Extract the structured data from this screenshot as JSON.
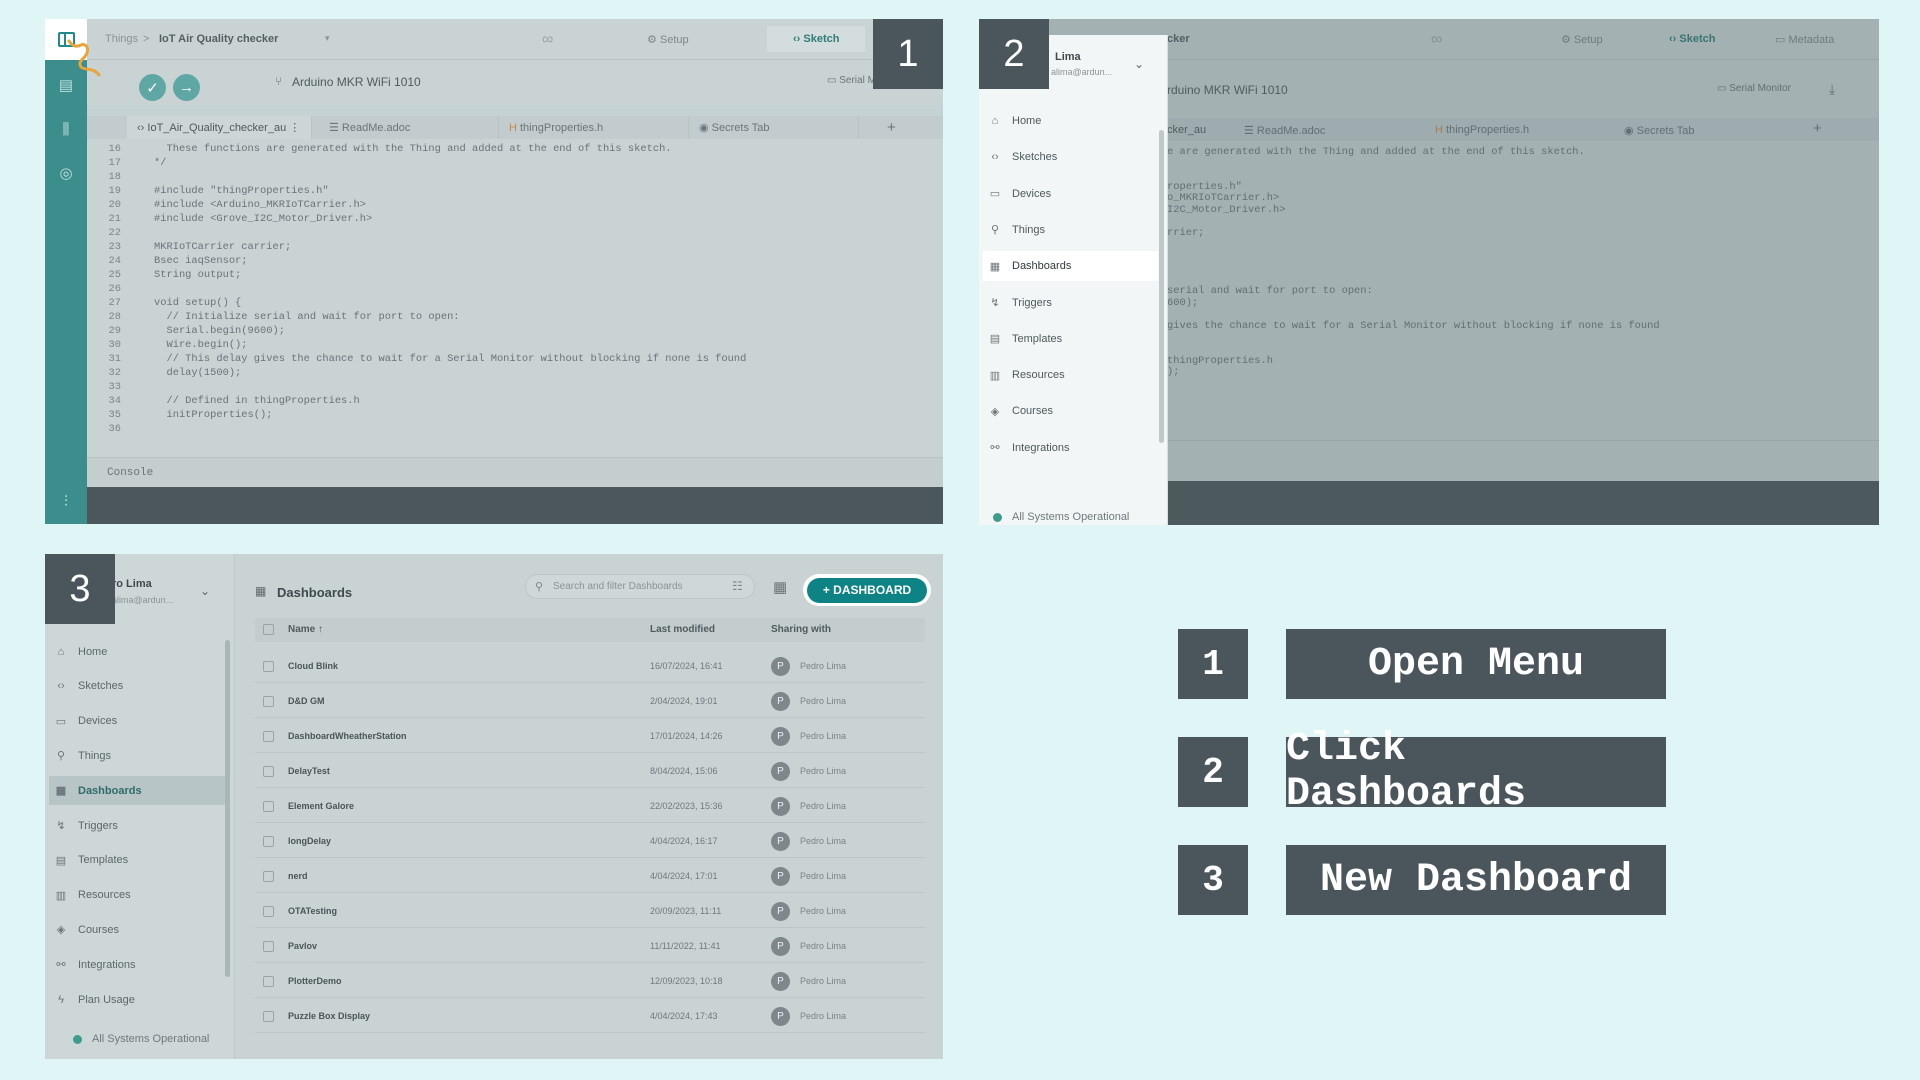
{
  "panel1": {
    "badge": "1",
    "breadcrumb": [
      "Things",
      "IoT Air Quality checker"
    ],
    "topbar": {
      "setup": "Setup",
      "sketch": "Sketch"
    },
    "board": "Arduino MKR WiFi 1010",
    "serial_monitor": "Serial Monitor",
    "tabs": [
      "IoT_Air_Quality_checker_au",
      "ReadMe.adoc",
      "thingProperties.h",
      "Secrets Tab"
    ],
    "code": [
      {
        "n": "16",
        "t": "  These functions are generated with the Thing and added at the end of this sketch."
      },
      {
        "n": "17",
        "t": "*/"
      },
      {
        "n": "18",
        "t": ""
      },
      {
        "n": "19",
        "t": "#include \"thingProperties.h\""
      },
      {
        "n": "20",
        "t": "#include <Arduino_MKRIoTCarrier.h>"
      },
      {
        "n": "21",
        "t": "#include <Grove_I2C_Motor_Driver.h>"
      },
      {
        "n": "22",
        "t": ""
      },
      {
        "n": "23",
        "t": "MKRIoTCarrier carrier;"
      },
      {
        "n": "24",
        "t": "Bsec iaqSensor;"
      },
      {
        "n": "25",
        "t": "String output;"
      },
      {
        "n": "26",
        "t": ""
      },
      {
        "n": "27",
        "t": "void setup() {"
      },
      {
        "n": "28",
        "t": "  // Initialize serial and wait for port to open:"
      },
      {
        "n": "29",
        "t": "  Serial.begin(9600);"
      },
      {
        "n": "30",
        "t": "  Wire.begin();"
      },
      {
        "n": "31",
        "t": "  // This delay gives the chance to wait for a Serial Monitor without blocking if none is found"
      },
      {
        "n": "32",
        "t": "  delay(1500);"
      },
      {
        "n": "33",
        "t": ""
      },
      {
        "n": "34",
        "t": "  // Defined in thingProperties.h"
      },
      {
        "n": "35",
        "t": "  initProperties();"
      },
      {
        "n": "36",
        "t": ""
      }
    ],
    "console": "Console"
  },
  "panel2": {
    "badge": "2",
    "user_name": "Lima",
    "user_email": "alima@ardun...",
    "menu": [
      {
        "label": "Home",
        "icon": "home-icon",
        "glyph": "⌂"
      },
      {
        "label": "Sketches",
        "icon": "code-icon",
        "glyph": "‹›"
      },
      {
        "label": "Devices",
        "icon": "devices-icon",
        "glyph": "▭"
      },
      {
        "label": "Things",
        "icon": "things-icon",
        "glyph": "⚲"
      },
      {
        "label": "Dashboards",
        "icon": "dashboards-icon",
        "glyph": "▦"
      },
      {
        "label": "Triggers",
        "icon": "triggers-icon",
        "glyph": "↯"
      },
      {
        "label": "Templates",
        "icon": "templates-icon",
        "glyph": "▤"
      },
      {
        "label": "Resources",
        "icon": "resources-icon",
        "glyph": "▥"
      },
      {
        "label": "Courses",
        "icon": "courses-icon",
        "glyph": "◈"
      },
      {
        "label": "Integrations",
        "icon": "integrations-icon",
        "glyph": "⚯"
      }
    ],
    "status": "All Systems Operational",
    "topbar": {
      "title_fragment": "cker",
      "setup": "Setup",
      "sketch": "Sketch",
      "metadata": "Metadata"
    },
    "board_fragment": "rduino MKR WiFi 1010",
    "serial_monitor": "Serial Monitor",
    "tabs": [
      "cker_au",
      "ReadMe.adoc",
      "thingProperties.h",
      "Secrets Tab"
    ],
    "code": [
      "e are generated with the Thing and added at the end of this sketch.",
      "",
      "",
      "roperties.h\"",
      "o_MKRIoTCarrier.h>",
      "I2C_Motor_Driver.h>",
      "",
      "rrier;",
      "",
      "",
      "",
      "",
      "serial and wait for port to open:",
      "600);",
      "",
      "gives the chance to wait for a Serial Monitor without blocking if none is found",
      "",
      "",
      "thingProperties.h",
      ");"
    ]
  },
  "panel3": {
    "badge": "3",
    "user_name": "ro Lima",
    "user_email": "alima@ardun...",
    "menu": [
      {
        "label": "Home",
        "icon": "home-icon",
        "glyph": "⌂"
      },
      {
        "label": "Sketches",
        "icon": "code-icon",
        "glyph": "‹›"
      },
      {
        "label": "Devices",
        "icon": "devices-icon",
        "glyph": "▭"
      },
      {
        "label": "Things",
        "icon": "things-icon",
        "glyph": "⚲"
      },
      {
        "label": "Dashboards",
        "icon": "dashboards-icon",
        "glyph": "▦"
      },
      {
        "label": "Triggers",
        "icon": "triggers-icon",
        "glyph": "↯"
      },
      {
        "label": "Templates",
        "icon": "templates-icon",
        "glyph": "▤"
      },
      {
        "label": "Resources",
        "icon": "resources-icon",
        "glyph": "▥"
      },
      {
        "label": "Courses",
        "icon": "courses-icon",
        "glyph": "◈"
      },
      {
        "label": "Integrations",
        "icon": "integrations-icon",
        "glyph": "⚯"
      },
      {
        "label": "Plan Usage",
        "icon": "plan-usage-icon",
        "glyph": "ϟ"
      }
    ],
    "status": "All Systems Operational",
    "title": "Dashboards",
    "search_placeholder": "Search and filter Dashboards",
    "new_button": "+ DASHBOARD",
    "columns": [
      "Name",
      "Last modified",
      "Sharing with"
    ],
    "rows": [
      {
        "name": "Cloud Blink",
        "date": "16/07/2024, 16:41",
        "avatar": "P",
        "owner": "Pedro Lima"
      },
      {
        "name": "D&D GM",
        "date": "2/04/2024, 19:01",
        "avatar": "P",
        "owner": "Pedro Lima"
      },
      {
        "name": "DashboardWheatherStation",
        "date": "17/01/2024, 14:26",
        "avatar": "P",
        "owner": "Pedro Lima"
      },
      {
        "name": "DelayTest",
        "date": "8/04/2024, 15:06",
        "avatar": "P",
        "owner": "Pedro Lima"
      },
      {
        "name": "Element Galore",
        "date": "22/02/2023, 15:36",
        "avatar": "P",
        "owner": "Pedro Lima"
      },
      {
        "name": "longDelay",
        "date": "4/04/2024, 16:17",
        "avatar": "P",
        "owner": "Pedro Lima"
      },
      {
        "name": "nerd",
        "date": "4/04/2024, 17:01",
        "avatar": "P",
        "owner": "Pedro Lima"
      },
      {
        "name": "OTATesting",
        "date": "20/09/2023, 11:11",
        "avatar": "P",
        "owner": "Pedro Lima"
      },
      {
        "name": "Pavlov",
        "date": "11/11/2022, 11:41",
        "avatar": "P",
        "owner": "Pedro Lima"
      },
      {
        "name": "PlotterDemo",
        "date": "12/09/2023, 10:18",
        "avatar": "P",
        "owner": "Pedro Lima"
      },
      {
        "name": "Puzzle Box Display",
        "date": "4/04/2024, 17:43",
        "avatar": "P",
        "owner": "Pedro Lima"
      }
    ]
  },
  "steps": [
    {
      "num": "1",
      "label": "Open Menu"
    },
    {
      "num": "2",
      "label": "Click Dashboards"
    },
    {
      "num": "3",
      "label": "New Dashboard"
    }
  ],
  "colors": {
    "accent": "#0d8386",
    "badge": "#4b565c",
    "background": "#dff5f6",
    "rail": "#3c8e8d",
    "cursor": "#e8a53a"
  }
}
